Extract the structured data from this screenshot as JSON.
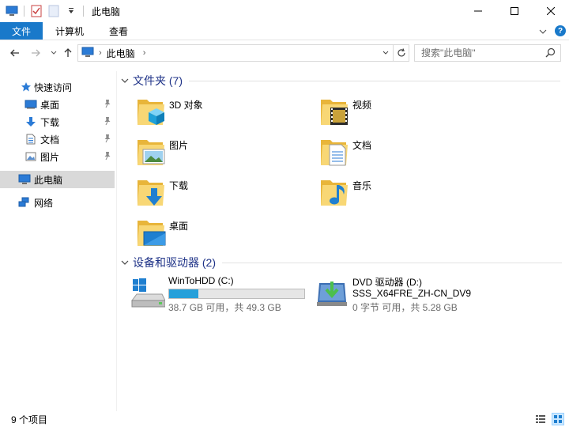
{
  "window": {
    "title": "此电脑"
  },
  "ribbon": {
    "tabs": [
      "文件",
      "计算机",
      "查看"
    ]
  },
  "address": {
    "crumb": "此电脑"
  },
  "search": {
    "placeholder": "搜索\"此电脑\""
  },
  "sidebar": {
    "quick_access": "快速访问",
    "quick_items": [
      "桌面",
      "下载",
      "文档",
      "图片"
    ],
    "this_pc": "此电脑",
    "network": "网络"
  },
  "content": {
    "folders_header": "文件夹 (7)",
    "folders": [
      {
        "name": "3D 对象",
        "icon": "3d-objects-folder-icon"
      },
      {
        "name": "视频",
        "icon": "videos-folder-icon"
      },
      {
        "name": "图片",
        "icon": "pictures-folder-icon"
      },
      {
        "name": "文档",
        "icon": "documents-folder-icon"
      },
      {
        "name": "下载",
        "icon": "downloads-folder-icon"
      },
      {
        "name": "音乐",
        "icon": "music-folder-icon"
      },
      {
        "name": "桌面",
        "icon": "desktop-folder-icon"
      }
    ],
    "devices_header": "设备和驱动器 (2)",
    "drives": [
      {
        "name": "WinToHDD (C:)",
        "free_text": "38.7 GB 可用，共 49.3 GB",
        "used_fraction": 0.215,
        "icon": "windows-drive-icon"
      },
      {
        "name": "DVD 驱动器 (D:)",
        "label": "SSS_X64FRE_ZH-CN_DV9",
        "free_text": "0 字节 可用，共 5.28 GB",
        "icon": "dvd-drive-icon"
      }
    ]
  },
  "status": {
    "count": "9 个项目"
  },
  "colors": {
    "accent": "#1979ca",
    "header_text": "#1e3287",
    "folder_yellow": "#f8d775",
    "progress_fill": "#26a0da",
    "selection": "#d9d9d9"
  }
}
